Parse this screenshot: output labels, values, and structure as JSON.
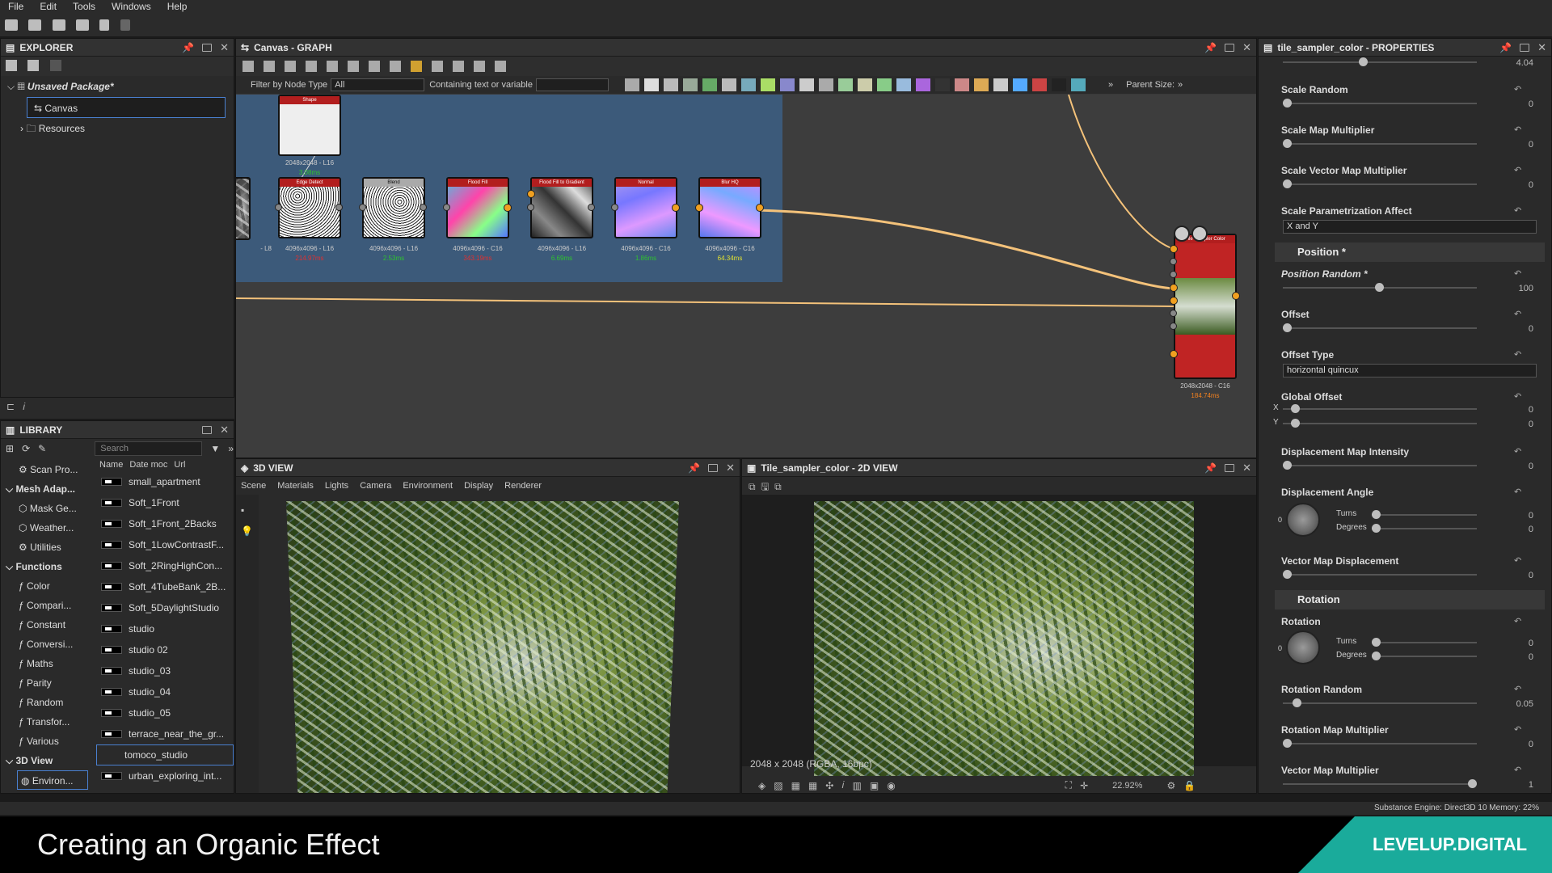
{
  "menu": [
    "File",
    "Edit",
    "Tools",
    "Windows",
    "Help"
  ],
  "explorer": {
    "title": "EXPLORER",
    "package": "Unsaved Package*",
    "items": [
      "Canvas",
      "Resources"
    ]
  },
  "graph": {
    "title": "Canvas - GRAPH",
    "filter_label": "Filter by Node Type",
    "filter_value": "All",
    "contains_label": "Containing text or variable",
    "parent_size_label": "Parent Size:",
    "nodes": [
      {
        "name": "Shape",
        "res": "2048x2048 - L16",
        "time": "3.08ms",
        "time_color": "#2ec42e"
      },
      {
        "name": "",
        "res": "- L8",
        "time": "",
        "time_color": "#ccc"
      },
      {
        "name": "Edge Detect",
        "res": "4096x4096 - L16",
        "time": "214.97ms",
        "time_color": "#e03030"
      },
      {
        "name": "Blend",
        "res": "4096x4096 - L16",
        "time": "2.53ms",
        "time_color": "#2ec42e"
      },
      {
        "name": "Flood Fill",
        "res": "4096x4096 - C16",
        "time": "343.19ms",
        "time_color": "#e03030"
      },
      {
        "name": "Flood Fill to Gradient",
        "res": "4096x4096 - L16",
        "time": "6.69ms",
        "time_color": "#2ec42e"
      },
      {
        "name": "Normal",
        "res": "4096x4096 - C16",
        "time": "1.86ms",
        "time_color": "#2ec42e"
      },
      {
        "name": "Blur HQ",
        "res": "4096x4096 - C16",
        "time": "64.34ms",
        "time_color": "#e0e030"
      },
      {
        "name": "Tile Sampler Color",
        "res": "2048x2048 - C16",
        "time": "184.74ms",
        "time_color": "#f08020"
      }
    ]
  },
  "library": {
    "title": "LIBRARY",
    "search_placeholder": "Search",
    "columns": [
      "Name",
      "Date moc",
      "Url"
    ],
    "categories": [
      "Scan Pro...",
      "Mesh Adap...",
      "Mask Ge...",
      "Weather...",
      "Utilities",
      "Functions",
      "Color",
      "Compari...",
      "Constant",
      "Conversi...",
      "Maths",
      "Parity",
      "Random",
      "Transfor...",
      "Various",
      "3D View",
      "Environ..."
    ],
    "items": [
      "small_apartment",
      "Soft_1Front",
      "Soft_1Front_2Backs",
      "Soft_1LowContrastF...",
      "Soft_2RingHighCon...",
      "Soft_4TubeBank_2B...",
      "Soft_5DaylightStudio",
      "studio",
      "studio 02",
      "studio_03",
      "studio_04",
      "studio_05",
      "terrace_near_the_gr...",
      "tomoco_studio",
      "urban_exploring_int..."
    ]
  },
  "view3d": {
    "title": "3D VIEW",
    "tabs": [
      "Scene",
      "Materials",
      "Lights",
      "Camera",
      "Environment",
      "Display",
      "Renderer"
    ]
  },
  "view2d": {
    "title": "Tile_sampler_color - 2D VIEW",
    "info": "2048 x 2048 (RGBA, 16bpc)",
    "zoom": "22.92%"
  },
  "properties": {
    "title": "tile_sampler_color - PROPERTIES",
    "top_value": "4.04",
    "scale_random": {
      "label": "Scale Random",
      "value": "0"
    },
    "scale_map_multiplier": {
      "label": "Scale Map Multiplier",
      "value": "0"
    },
    "scale_vector_map_multiplier": {
      "label": "Scale Vector Map Multiplier",
      "value": "0"
    },
    "scale_param_affect": {
      "label": "Scale Parametrization Affect",
      "value": "X and Y"
    },
    "position_section": "Position *",
    "position_random": {
      "label": "Position Random *",
      "value": "100"
    },
    "offset": {
      "label": "Offset",
      "value": "0"
    },
    "offset_type": {
      "label": "Offset Type",
      "value": "horizontal quincux"
    },
    "global_offset": {
      "label": "Global Offset",
      "x_label": "X",
      "y_label": "Y",
      "x": "0",
      "y": "0"
    },
    "displacement_map_intensity": {
      "label": "Displacement Map Intensity",
      "value": "0"
    },
    "displacement_angle": {
      "label": "Displacement Angle",
      "turns_label": "Turns",
      "degrees_label": "Degrees",
      "turns": "0",
      "degrees": "0",
      "dial": "0"
    },
    "vector_map_displacement": {
      "label": "Vector Map Displacement",
      "value": "0"
    },
    "rotation_section": "Rotation",
    "rotation": {
      "label": "Rotation",
      "turns_label": "Turns",
      "degrees_label": "Degrees",
      "turns": "0",
      "degrees": "0",
      "dial": "0"
    },
    "rotation_random": {
      "label": "Rotation Random",
      "value": "0.05"
    },
    "rotation_map_multiplier": {
      "label": "Rotation Map Multiplier",
      "value": "0"
    },
    "vector_map_multiplier": {
      "label": "Vector Map Multiplier",
      "value": "1"
    }
  },
  "status": {
    "text": "Substance Engine: Direct3D 10  Memory: 22%"
  },
  "banner": {
    "title": "Creating an Organic Effect",
    "brand": "LEVELUP.DIGITAL"
  }
}
